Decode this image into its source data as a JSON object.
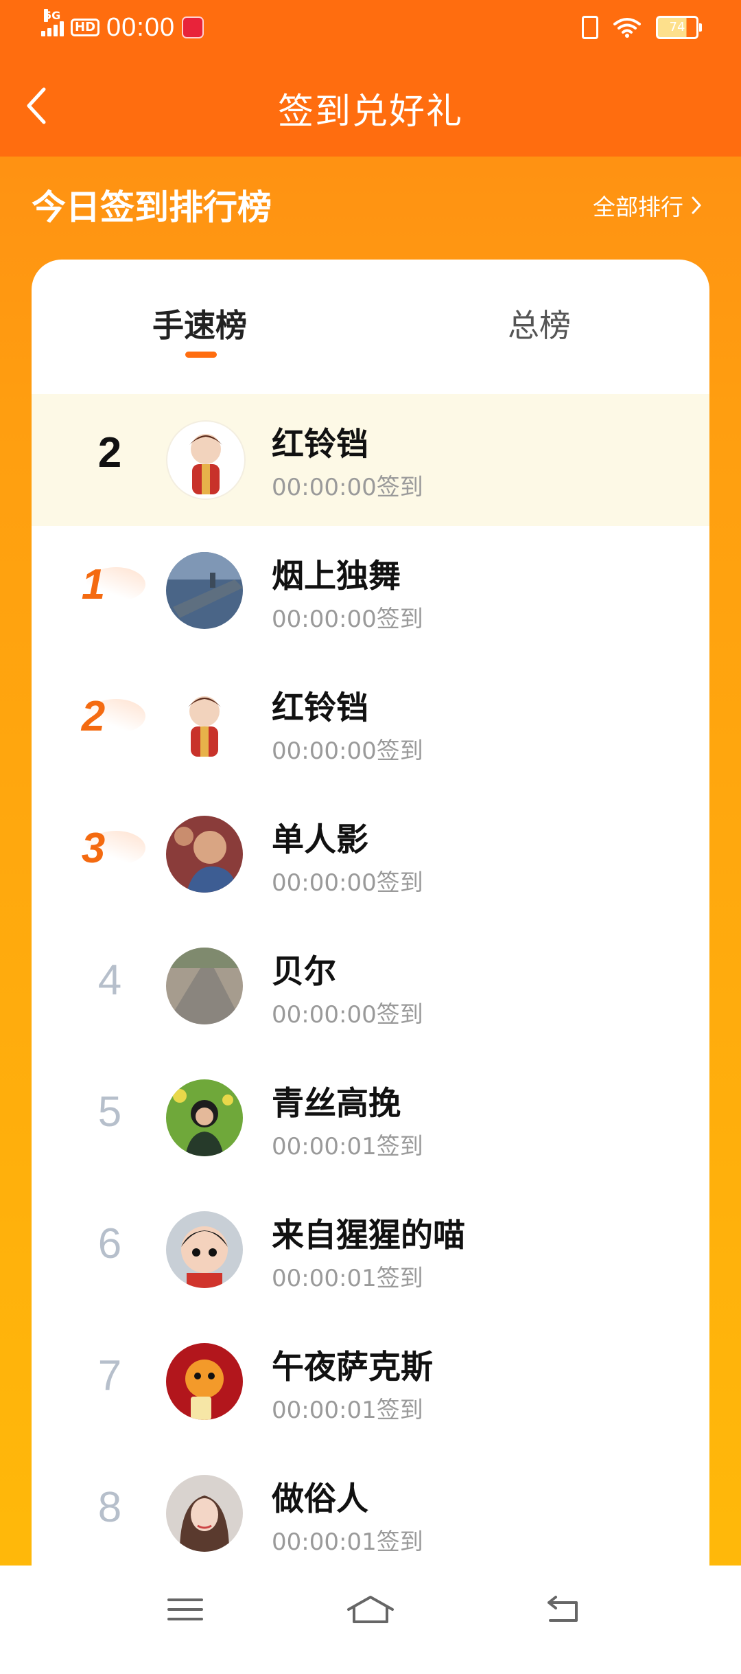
{
  "status": {
    "net": "5G",
    "hd": "HD",
    "time": "00:00",
    "battery": "74"
  },
  "header": {
    "title": "签到兑好礼"
  },
  "ranking": {
    "title": "今日签到排行榜",
    "all_label": "全部排行"
  },
  "tabs": {
    "active": "手速榜",
    "inactive": "总榜"
  },
  "rows": [
    {
      "rank": "2",
      "name": "红铃铛",
      "time": "00:00:00签到",
      "highlight": true
    },
    {
      "rank": "1",
      "name": "烟上独舞",
      "time": "00:00:00签到"
    },
    {
      "rank": "2",
      "name": "红铃铛",
      "time": "00:00:00签到"
    },
    {
      "rank": "3",
      "name": "单人影",
      "time": "00:00:00签到"
    },
    {
      "rank": "4",
      "name": "贝尔",
      "time": "00:00:00签到"
    },
    {
      "rank": "5",
      "name": "青丝高挽",
      "time": "00:00:01签到"
    },
    {
      "rank": "6",
      "name": "来自猩猩的喵",
      "time": "00:00:01签到"
    },
    {
      "rank": "7",
      "name": "午夜萨克斯",
      "time": "00:00:01签到"
    },
    {
      "rank": "8",
      "name": "做俗人",
      "time": "00:00:01签到"
    }
  ],
  "colors": {
    "brand": "#ff6d0f",
    "top_rank": "#f46a10",
    "highlight_row": "#fdf9e6"
  }
}
